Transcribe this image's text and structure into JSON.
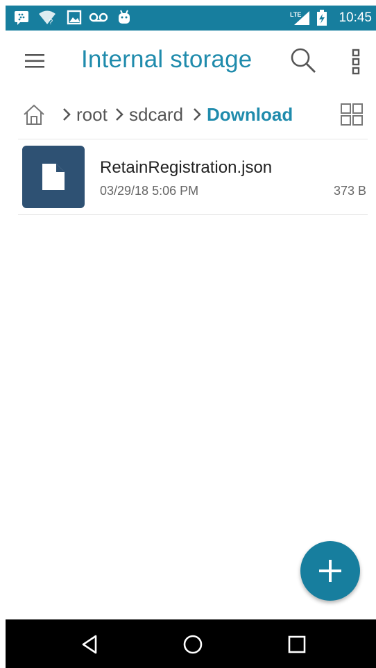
{
  "status_bar": {
    "time": "10:45",
    "icons": [
      "blackberry-messenger-icon",
      "wifi-icon",
      "image-icon",
      "voicemail-icon",
      "android-icon",
      "lte-signal-icon",
      "battery-charging-icon"
    ],
    "background_color": "#177e9e"
  },
  "toolbar": {
    "title": "Internal storage",
    "menu_icon": "hamburger-menu-icon",
    "search_icon": "search-icon",
    "more_icon": "more-vertical-icon",
    "title_color": "#1f8bac"
  },
  "breadcrumb": {
    "home_icon": "home-icon",
    "items": [
      {
        "label": "root"
      },
      {
        "label": "sdcard"
      },
      {
        "label": "Download"
      }
    ],
    "view_toggle_icon": "grid-view-icon"
  },
  "files": [
    {
      "name": "RetainRegistration.json",
      "date": "03/29/18 5:06 PM",
      "size": "373 B",
      "icon": "file-icon",
      "thumb_color": "#2e5173"
    }
  ],
  "fab": {
    "icon": "plus-icon",
    "color": "#177e9e"
  },
  "nav_bar": {
    "buttons": [
      "back-icon",
      "home-circle-icon",
      "recents-icon"
    ]
  }
}
